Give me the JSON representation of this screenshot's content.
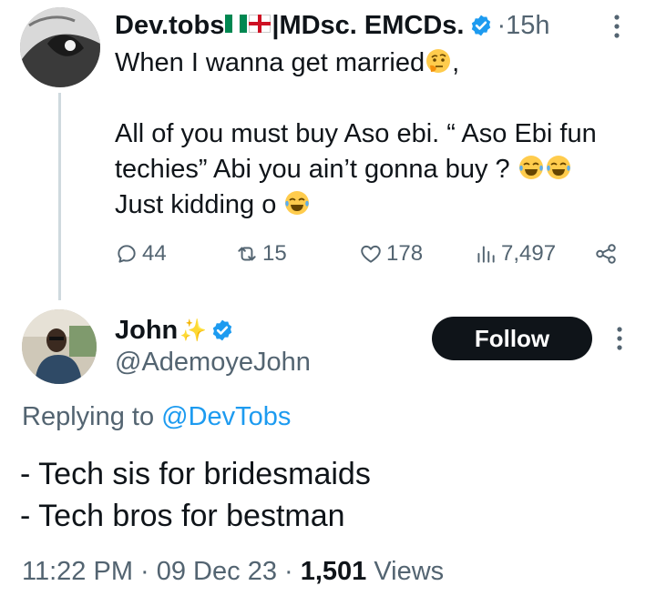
{
  "parent_tweet": {
    "display_name": "Dev.tobs",
    "name_suffix": "|MDsc. EMCDs.",
    "separator": " · ",
    "time": "15h",
    "text_lines": [
      "When I wanna get married",
      "",
      "All of you must buy Aso ebi. “ Aso Ebi fun",
      "techies”  Abi you ain’t gonna buy ?",
      "Just kidding o"
    ],
    "after_first_line": ",",
    "emojis": [
      "thinking-face",
      "tears-of-joy",
      "tears-of-joy",
      "tears-of-joy"
    ],
    "flags": [
      "nigeria-flag",
      "england-flag"
    ],
    "stats": {
      "replies": "44",
      "reposts": "15",
      "likes": "178",
      "views": "7,497"
    }
  },
  "reply": {
    "display_name": "John",
    "sparkle": "✨",
    "handle": "@AdemoyeJohn",
    "follow_label": "Follow",
    "replying_prefix": "Replying to ",
    "replying_to": "@DevTobs",
    "body_lines": [
      "- Tech sis for bridesmaids",
      "- Tech bros for bestman"
    ],
    "timestamp": "11:22 PM · 09 Dec 23 · ",
    "views_count": "1,501",
    "views_label": " Views"
  },
  "colors": {
    "text": "#0f1419",
    "secondary": "#536471",
    "accent": "#1d9bf0",
    "verified": "#1d9bf0",
    "thread_line": "#cfd9de"
  }
}
